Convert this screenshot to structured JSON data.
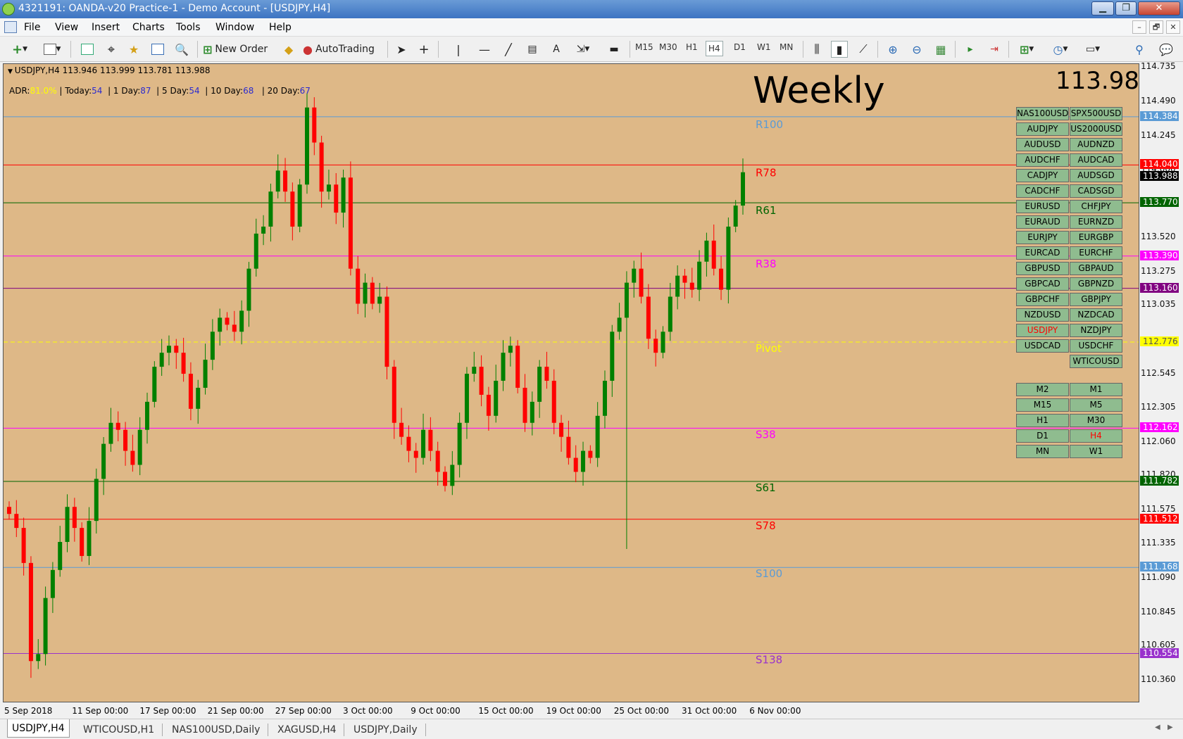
{
  "window": {
    "title": "4321191: OANDA-v20 Practice-1 - Demo Account - [USDJPY,H4]",
    "minimize": "▁",
    "maximize": "❐",
    "close": "✕",
    "mdi_minimize": "–",
    "mdi_restore": "🗗",
    "mdi_close": "✕"
  },
  "menu": [
    "File",
    "View",
    "Insert",
    "Charts",
    "Tools",
    "Window",
    "Help"
  ],
  "toolbar": {
    "new_order": "New Order",
    "autotrading": "AutoTrading",
    "text_tool": "A",
    "timeframes": [
      "M15",
      "M30",
      "H1",
      "H4",
      "D1",
      "W1",
      "MN"
    ],
    "active_timeframe": "H4"
  },
  "chart": {
    "header": "USDJPY,H4  113.946 113.999 113.781 113.988",
    "adr_label": "ADR:",
    "adr_value": "81.0%",
    "today_label": "| Today:",
    "today_value": "54",
    "day1_label": "| 1 Day:",
    "day1_value": "87",
    "day5_label": "| 5 Day:",
    "day5_value": "54",
    "day10_label": "| 10 Day:",
    "day10_value": "68",
    "day20_label": "| 20 Day:",
    "day20_value": "67",
    "period_label": "Weekly",
    "current_price": "113.988",
    "colors": {
      "background": "#deb887",
      "bull": "#008000",
      "bear": "#ff0000",
      "info_value": "#2a2ad0",
      "adr_value": "#ffff00"
    }
  },
  "chart_data": {
    "type": "candlestick",
    "symbol": "USDJPY",
    "timeframe": "H4",
    "ylim": [
      110.2,
      114.76
    ],
    "price_ticks": [
      "114.735",
      "114.490",
      "114.245",
      "114.000",
      "113.520",
      "113.275",
      "113.035",
      "112.545",
      "112.305",
      "112.060",
      "111.820",
      "111.575",
      "111.335",
      "111.090",
      "110.845",
      "110.605",
      "110.360"
    ],
    "time_labels": [
      "5 Sep 2018",
      "11 Sep 00:00",
      "17 Sep 00:00",
      "21 Sep 00:00",
      "27 Sep 00:00",
      "3 Oct 00:00",
      "9 Oct 00:00",
      "15 Oct 00:00",
      "19 Oct 00:00",
      "25 Oct 00:00",
      "31 Oct 00:00",
      "6 Nov 00:00"
    ],
    "levels": [
      {
        "name": "R100",
        "price": 114.384,
        "label": "114.384",
        "color": "#5b9bd5"
      },
      {
        "name": "R78",
        "price": 114.04,
        "label": "114.040",
        "color": "#ff0000"
      },
      {
        "name": "R61",
        "price": 113.77,
        "label": "113.770",
        "color": "#006400"
      },
      {
        "name": "R38",
        "price": 113.39,
        "label": "113.390",
        "color": "#ff00ff"
      },
      {
        "name": "",
        "price": 113.16,
        "label": "113.160",
        "color": "#800080"
      },
      {
        "name": "Pivot",
        "price": 112.776,
        "label": "112.776",
        "color": "#ffff00"
      },
      {
        "name": "S38",
        "price": 112.162,
        "label": "112.162",
        "color": "#ff00ff"
      },
      {
        "name": "S61",
        "price": 111.782,
        "label": "111.782",
        "color": "#006400"
      },
      {
        "name": "S78",
        "price": 111.512,
        "label": "111.512",
        "color": "#ff0000"
      },
      {
        "name": "S100",
        "price": 111.168,
        "label": "111.168",
        "color": "#5b9bd5"
      },
      {
        "name": "S138",
        "price": 110.554,
        "label": "110.554",
        "color": "#9932cc"
      }
    ],
    "current": {
      "price": 113.988,
      "label": "113.988"
    },
    "path": [
      111.55,
      111.45,
      111.2,
      110.5,
      110.55,
      110.95,
      111.15,
      111.35,
      111.6,
      111.45,
      111.25,
      111.5,
      111.8,
      112.05,
      112.2,
      112.15,
      112.0,
      111.9,
      112.15,
      112.35,
      112.6,
      112.7,
      112.75,
      112.7,
      112.55,
      112.3,
      112.45,
      112.65,
      112.85,
      112.95,
      112.9,
      112.85,
      113.0,
      113.3,
      113.55,
      113.6,
      113.85,
      114.0,
      113.85,
      113.6,
      113.9,
      114.45,
      114.2,
      113.85,
      113.9,
      113.7,
      113.95,
      113.3,
      113.05,
      113.2,
      113.05,
      113.1,
      112.6,
      112.2,
      112.1,
      112.0,
      111.95,
      112.15,
      112.0,
      111.85,
      111.75,
      111.9,
      112.2,
      112.55,
      112.6,
      112.4,
      112.25,
      112.5,
      112.7,
      112.75,
      112.45,
      112.2,
      112.35,
      112.6,
      112.5,
      112.2,
      112.1,
      111.95,
      111.85,
      112.0,
      111.95,
      112.25,
      112.5,
      112.85,
      112.95,
      113.2,
      113.3,
      113.1,
      112.8,
      112.7,
      112.85,
      113.1,
      113.25,
      113.2,
      113.15,
      113.35,
      113.5,
      113.3,
      113.15,
      113.6,
      113.75,
      113.988
    ],
    "wick_amplitude": 0.1,
    "spikes": [
      {
        "index": 85,
        "low": 111.3
      },
      {
        "index": 41,
        "high": 114.55
      },
      {
        "index": 3,
        "low": 110.38
      }
    ]
  },
  "symbols": {
    "left": [
      "NAS100USD",
      "AUDJPY",
      "AUDUSD",
      "AUDCHF",
      "CADJPY",
      "CADCHF",
      "EURUSD",
      "EURAUD",
      "EURJPY",
      "EURCAD",
      "GBPUSD",
      "GBPCAD",
      "GBPCHF",
      "NZDUSD",
      "USDJPY",
      "USDCAD"
    ],
    "right": [
      "SPX500USD",
      "US2000USD",
      "AUDNZD",
      "AUDCAD",
      "AUDSGD",
      "CADSGD",
      "CHFJPY",
      "EURNZD",
      "EURGBP",
      "EURCHF",
      "GBPAUD",
      "GBPNZD",
      "GBPJPY",
      "NZDCAD",
      "NZDJPY",
      "USDCHF",
      "WTICOUSD"
    ],
    "active": "USDJPY",
    "active_color": "#ff0000"
  },
  "tf_buttons": {
    "left": [
      "M2",
      "M15",
      "H1",
      "D1",
      "MN"
    ],
    "right": [
      "M1",
      "M5",
      "M30",
      "H4",
      "W1"
    ],
    "active": "H4"
  },
  "tabs": [
    "USDJPY,H4",
    "WTICOUSD,H1",
    "NAS100USD,Daily",
    "XAGUSD,H4",
    "USDJPY,Daily"
  ],
  "active_tab": "USDJPY,H4"
}
